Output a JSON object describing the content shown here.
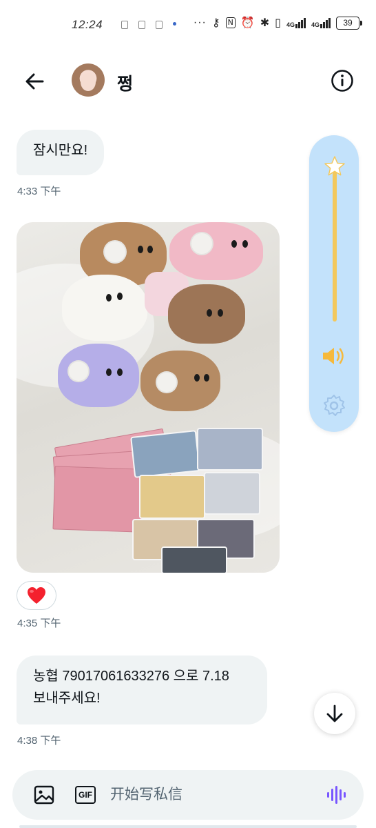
{
  "status_bar": {
    "time": "12:24",
    "overflow": "···",
    "network_1": "4G",
    "network_2": "4G",
    "battery": "39",
    "icons": [
      "key-icon",
      "nfc-icon",
      "alarm-icon",
      "bluetooth-icon",
      "vibrate-icon",
      "signal-icon",
      "signal-icon",
      "battery-icon"
    ]
  },
  "header": {
    "contact_name": "쩡",
    "back_icon": "arrow-left-icon",
    "info_icon": "info-circle-icon"
  },
  "messages": [
    {
      "text": "잠시만요!",
      "time": "4:33 下午"
    },
    {
      "type": "photo",
      "reaction": "❤️",
      "time": "4:35 下午"
    },
    {
      "text_line1": "농협 79017061633276 으로 7.18",
      "text_line2": "보내주세요!",
      "time": "4:38 下午"
    }
  ],
  "volume_panel": {
    "level": 1.0,
    "thumb_icon": "star-icon",
    "speaker_icon": "speaker-icon",
    "settings_icon": "gear-icon"
  },
  "composer": {
    "placeholder": "开始写私信",
    "value": "",
    "image_icon": "image-icon",
    "gif_label": "GIF",
    "voice_icon": "voice-wave-icon"
  },
  "colors": {
    "bubble": "#eff3f4",
    "muted_text": "#536471",
    "volume_panel": "#c3e2fb",
    "volume_track": "#f3c85c",
    "voice_accent": "#7856ff",
    "heart": "#f4212e"
  }
}
